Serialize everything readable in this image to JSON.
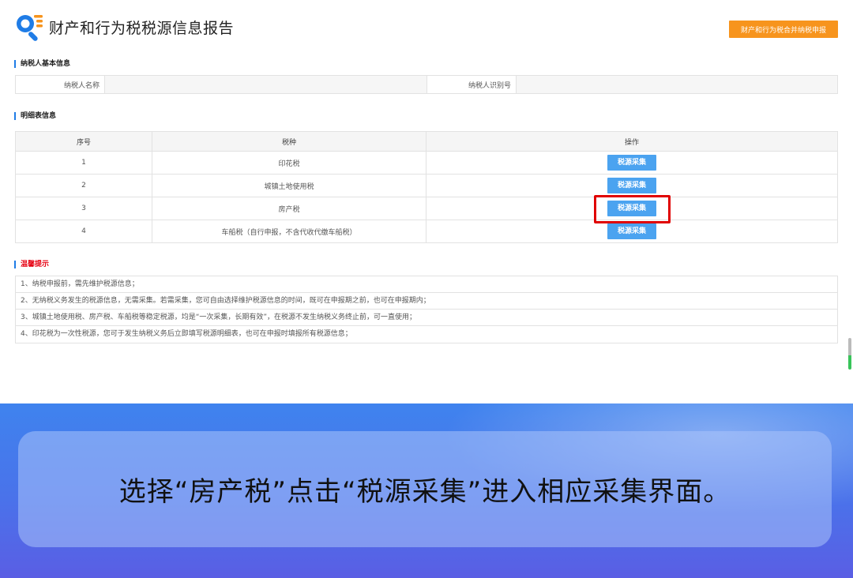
{
  "header": {
    "title": "财产和行为税税源信息报告",
    "merge_button": "财产和行为税合并纳税申报",
    "merge_button_color": "#f7941d"
  },
  "basic_info": {
    "section_title": "纳税人基本信息",
    "name_label": "纳税人名称",
    "name_value": "",
    "id_label": "纳税人识别号",
    "id_value": ""
  },
  "detail": {
    "section_title": "明细表信息",
    "columns": [
      "序号",
      "税种",
      "操作"
    ],
    "rows": [
      {
        "no": "1",
        "tax": "印花税",
        "action": "税源采集"
      },
      {
        "no": "2",
        "tax": "城镇土地使用税",
        "action": "税源采集"
      },
      {
        "no": "3",
        "tax": "房产税",
        "action": "税源采集"
      },
      {
        "no": "4",
        "tax": "车船税（自行申报，不含代收代缴车船税）",
        "action": "税源采集"
      }
    ],
    "button_color": "#4ba3f0",
    "highlight_color": "#e00000"
  },
  "tips": {
    "section_title": "温馨提示",
    "items": [
      "1、纳税申报前，需先维护税源信息；",
      "2、无纳税义务发生的税源信息，无需采集。若需采集，您可自由选择维护税源信息的时间，既可在申报期之前，也可在申报期内；",
      "3、城镇土地使用税、房产税、车船税等稳定税源，均是“一次采集，长期有效”，在税源不发生纳税义务终止前，可一直使用；",
      "4、印花税为一次性税源，您可于发生纳税义务后立即填写税源明细表，也可在申报时填报所有税源信息；"
    ]
  },
  "banner": {
    "caption": "选择“房产税”点击“税源采集”进入相应采集界面。"
  },
  "icons": {
    "logo": "search-document-icon"
  }
}
